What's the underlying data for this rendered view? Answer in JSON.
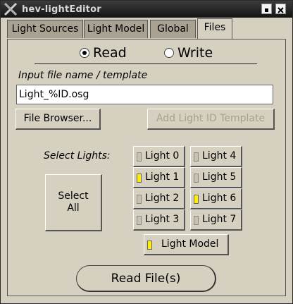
{
  "window": {
    "title": "hev-lightEditor"
  },
  "tabs": [
    {
      "label": "Light Sources"
    },
    {
      "label": "Light Model"
    },
    {
      "label": "Global"
    },
    {
      "label": "Files"
    }
  ],
  "mode": {
    "read_label": "Read",
    "write_label": "Write",
    "selected": "Read"
  },
  "file": {
    "label": "Input file name / template",
    "value": "Light_%ID.osg"
  },
  "buttons": {
    "browser": "File Browser...",
    "add_template": "Add Light ID Template",
    "read_files": "Read File(s)"
  },
  "select_lights": {
    "label": "Select Lights:",
    "select_all_line1": "Select",
    "select_all_line2": "All",
    "lights": [
      {
        "label": "Light 0",
        "on": false
      },
      {
        "label": "Light 1",
        "on": true
      },
      {
        "label": "Light 2",
        "on": false
      },
      {
        "label": "Light 3",
        "on": false
      },
      {
        "label": "Light 4",
        "on": false
      },
      {
        "label": "Light 5",
        "on": false
      },
      {
        "label": "Light 6",
        "on": true
      },
      {
        "label": "Light 7",
        "on": false
      }
    ],
    "light_model": {
      "label": "Light Model",
      "on": true
    }
  },
  "colors": {
    "indicator_on": "#ffee00",
    "background": "#d6d0c0",
    "tab_inactive": "#a9a292"
  }
}
